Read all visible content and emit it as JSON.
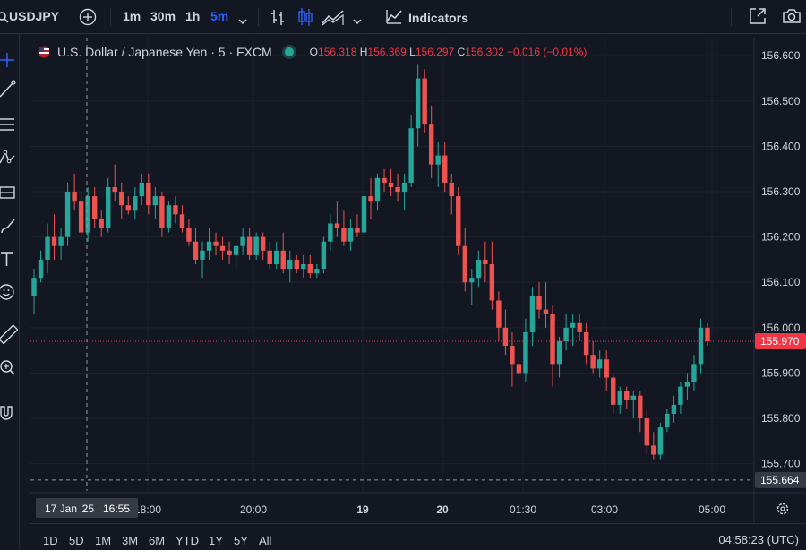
{
  "toolbar": {
    "symbol": "USDJPY",
    "timeframes": [
      "1m",
      "30m",
      "1h",
      "5m"
    ],
    "active_timeframe": "5m",
    "indicators_label": "Indicators"
  },
  "legend": {
    "title": "U.S. Dollar / Japanese Yen · 5 · FXCM",
    "open_label": "O",
    "open": "156.318",
    "high_label": "H",
    "high": "156.369",
    "low_label": "L",
    "low": "156.297",
    "close_label": "C",
    "close": "156.302",
    "change": "−0.016 (−0.01%)"
  },
  "price_axis": {
    "ticks": [
      "156.600",
      "156.500",
      "156.400",
      "156.300",
      "156.200",
      "156.100",
      "156.000",
      "155.900",
      "155.800",
      "155.700"
    ],
    "current_price": "155.970",
    "crosshair_price": "155.664"
  },
  "time_axis": {
    "ticks": [
      "18:00",
      "20:00",
      "19",
      "20",
      "01:30",
      "03:00",
      "05:00"
    ],
    "crosshair_label": "17 Jan '25   16:55"
  },
  "ranges": [
    "1D",
    "5D",
    "1M",
    "3M",
    "6M",
    "YTD",
    "1Y",
    "5Y",
    "All"
  ],
  "clock": "04:58:23 (UTC)",
  "colors": {
    "up": "#26a69a",
    "down": "#ef5350",
    "background": "#131722",
    "price_label": "#f23645",
    "accent": "#2962ff"
  },
  "chart_data": {
    "type": "candlestick",
    "ylim": [
      155.64,
      156.64
    ],
    "candles": [
      [
        156.07,
        156.13,
        156.03,
        156.11
      ],
      [
        156.11,
        156.17,
        156.1,
        156.15
      ],
      [
        156.15,
        156.23,
        156.12,
        156.2
      ],
      [
        156.2,
        156.25,
        156.15,
        156.18
      ],
      [
        156.18,
        156.22,
        156.15,
        156.2
      ],
      [
        156.2,
        156.32,
        156.18,
        156.3
      ],
      [
        156.3,
        156.34,
        156.26,
        156.28
      ],
      [
        156.28,
        156.3,
        156.2,
        156.21
      ],
      [
        156.21,
        156.31,
        156.19,
        156.29
      ],
      [
        156.29,
        156.31,
        156.22,
        156.24
      ],
      [
        156.24,
        156.26,
        156.2,
        156.22
      ],
      [
        156.22,
        156.33,
        156.21,
        156.31
      ],
      [
        156.31,
        156.36,
        156.28,
        156.3
      ],
      [
        156.3,
        156.32,
        156.24,
        156.27
      ],
      [
        156.27,
        156.29,
        156.25,
        156.26
      ],
      [
        156.26,
        156.31,
        156.24,
        156.29
      ],
      [
        156.29,
        156.34,
        156.27,
        156.32
      ],
      [
        156.32,
        156.34,
        156.25,
        156.27
      ],
      [
        156.27,
        156.31,
        156.24,
        156.29
      ],
      [
        156.29,
        156.3,
        156.2,
        156.22
      ],
      [
        156.22,
        156.28,
        156.21,
        156.27
      ],
      [
        156.27,
        156.29,
        156.23,
        156.25
      ],
      [
        156.25,
        156.27,
        156.21,
        156.22
      ],
      [
        156.22,
        156.24,
        156.18,
        156.19
      ],
      [
        156.19,
        156.22,
        156.14,
        156.15
      ],
      [
        156.15,
        156.19,
        156.11,
        156.17
      ],
      [
        156.17,
        156.22,
        156.15,
        156.19
      ],
      [
        156.19,
        156.21,
        156.16,
        156.18
      ],
      [
        156.18,
        156.2,
        156.15,
        156.17
      ],
      [
        156.17,
        156.19,
        156.14,
        156.16
      ],
      [
        156.16,
        156.19,
        156.13,
        156.18
      ],
      [
        156.18,
        156.22,
        156.16,
        156.2
      ],
      [
        156.2,
        156.22,
        156.15,
        156.16
      ],
      [
        156.16,
        156.21,
        156.15,
        156.2
      ],
      [
        156.2,
        156.21,
        156.15,
        156.17
      ],
      [
        156.17,
        156.19,
        156.13,
        156.14
      ],
      [
        156.14,
        156.19,
        156.13,
        156.17
      ],
      [
        156.17,
        156.21,
        156.12,
        156.13
      ],
      [
        156.13,
        156.17,
        156.1,
        156.15
      ],
      [
        156.15,
        156.16,
        156.12,
        156.13
      ],
      [
        156.13,
        156.16,
        156.11,
        156.14
      ],
      [
        156.14,
        156.16,
        156.11,
        156.12
      ],
      [
        156.12,
        156.14,
        156.11,
        156.13
      ],
      [
        156.13,
        156.2,
        156.12,
        156.19
      ],
      [
        156.19,
        156.25,
        156.17,
        156.23
      ],
      [
        156.23,
        156.28,
        156.2,
        156.22
      ],
      [
        156.22,
        156.26,
        156.18,
        156.19
      ],
      [
        156.19,
        156.24,
        156.17,
        156.22
      ],
      [
        156.22,
        156.25,
        156.2,
        156.21
      ],
      [
        156.21,
        156.31,
        156.2,
        156.29
      ],
      [
        156.29,
        156.33,
        156.24,
        156.28
      ],
      [
        156.28,
        156.34,
        156.26,
        156.33
      ],
      [
        156.33,
        156.35,
        156.3,
        156.32
      ],
      [
        156.32,
        156.35,
        156.29,
        156.31
      ],
      [
        156.31,
        156.34,
        156.28,
        156.3
      ],
      [
        156.3,
        156.34,
        156.26,
        156.32
      ],
      [
        156.32,
        156.47,
        156.31,
        156.44
      ],
      [
        156.44,
        156.58,
        156.4,
        156.55
      ],
      [
        156.55,
        156.57,
        156.43,
        156.45
      ],
      [
        156.45,
        156.49,
        156.33,
        156.36
      ],
      [
        156.36,
        156.41,
        156.31,
        156.38
      ],
      [
        156.38,
        156.41,
        156.3,
        156.32
      ],
      [
        156.32,
        156.34,
        156.25,
        156.29
      ],
      [
        156.29,
        156.31,
        156.16,
        156.18
      ],
      [
        156.18,
        156.22,
        156.08,
        156.1
      ],
      [
        156.1,
        156.13,
        156.05,
        156.11
      ],
      [
        156.11,
        156.17,
        156.09,
        156.15
      ],
      [
        156.15,
        156.19,
        156.1,
        156.14
      ],
      [
        156.14,
        156.19,
        156.04,
        156.06
      ],
      [
        156.06,
        156.08,
        155.97,
        156.0
      ],
      [
        156.0,
        156.04,
        155.94,
        155.96
      ],
      [
        155.96,
        155.99,
        155.87,
        155.92
      ],
      [
        155.92,
        155.95,
        155.89,
        155.9
      ],
      [
        155.9,
        156.02,
        155.88,
        155.99
      ],
      [
        155.99,
        156.09,
        155.96,
        156.07
      ],
      [
        156.07,
        156.1,
        156.02,
        156.04
      ],
      [
        156.04,
        156.1,
        156.0,
        156.03
      ],
      [
        156.03,
        156.05,
        155.87,
        155.92
      ],
      [
        155.92,
        155.98,
        155.89,
        155.97
      ],
      [
        155.97,
        156.03,
        155.95,
        156.0
      ],
      [
        156.0,
        156.03,
        155.96,
        156.01
      ],
      [
        156.01,
        156.03,
        155.97,
        155.99
      ],
      [
        155.99,
        156.01,
        155.92,
        155.94
      ],
      [
        155.94,
        155.97,
        155.9,
        155.91
      ],
      [
        155.91,
        155.95,
        155.89,
        155.93
      ],
      [
        155.93,
        155.95,
        155.86,
        155.89
      ],
      [
        155.89,
        155.9,
        155.81,
        155.83
      ],
      [
        155.83,
        155.87,
        155.81,
        155.86
      ],
      [
        155.86,
        155.87,
        155.82,
        155.84
      ],
      [
        155.84,
        155.86,
        155.8,
        155.85
      ],
      [
        155.85,
        155.86,
        155.77,
        155.8
      ],
      [
        155.8,
        155.82,
        155.72,
        155.74
      ],
      [
        155.74,
        155.77,
        155.71,
        155.72
      ],
      [
        155.72,
        155.79,
        155.71,
        155.78
      ],
      [
        155.78,
        155.82,
        155.77,
        155.81
      ],
      [
        155.81,
        155.85,
        155.79,
        155.83
      ],
      [
        155.83,
        155.88,
        155.81,
        155.87
      ],
      [
        155.87,
        155.9,
        155.84,
        155.88
      ],
      [
        155.88,
        155.94,
        155.86,
        155.92
      ],
      [
        155.92,
        156.02,
        155.9,
        156.0
      ],
      [
        156.0,
        156.01,
        155.96,
        155.97
      ]
    ]
  }
}
